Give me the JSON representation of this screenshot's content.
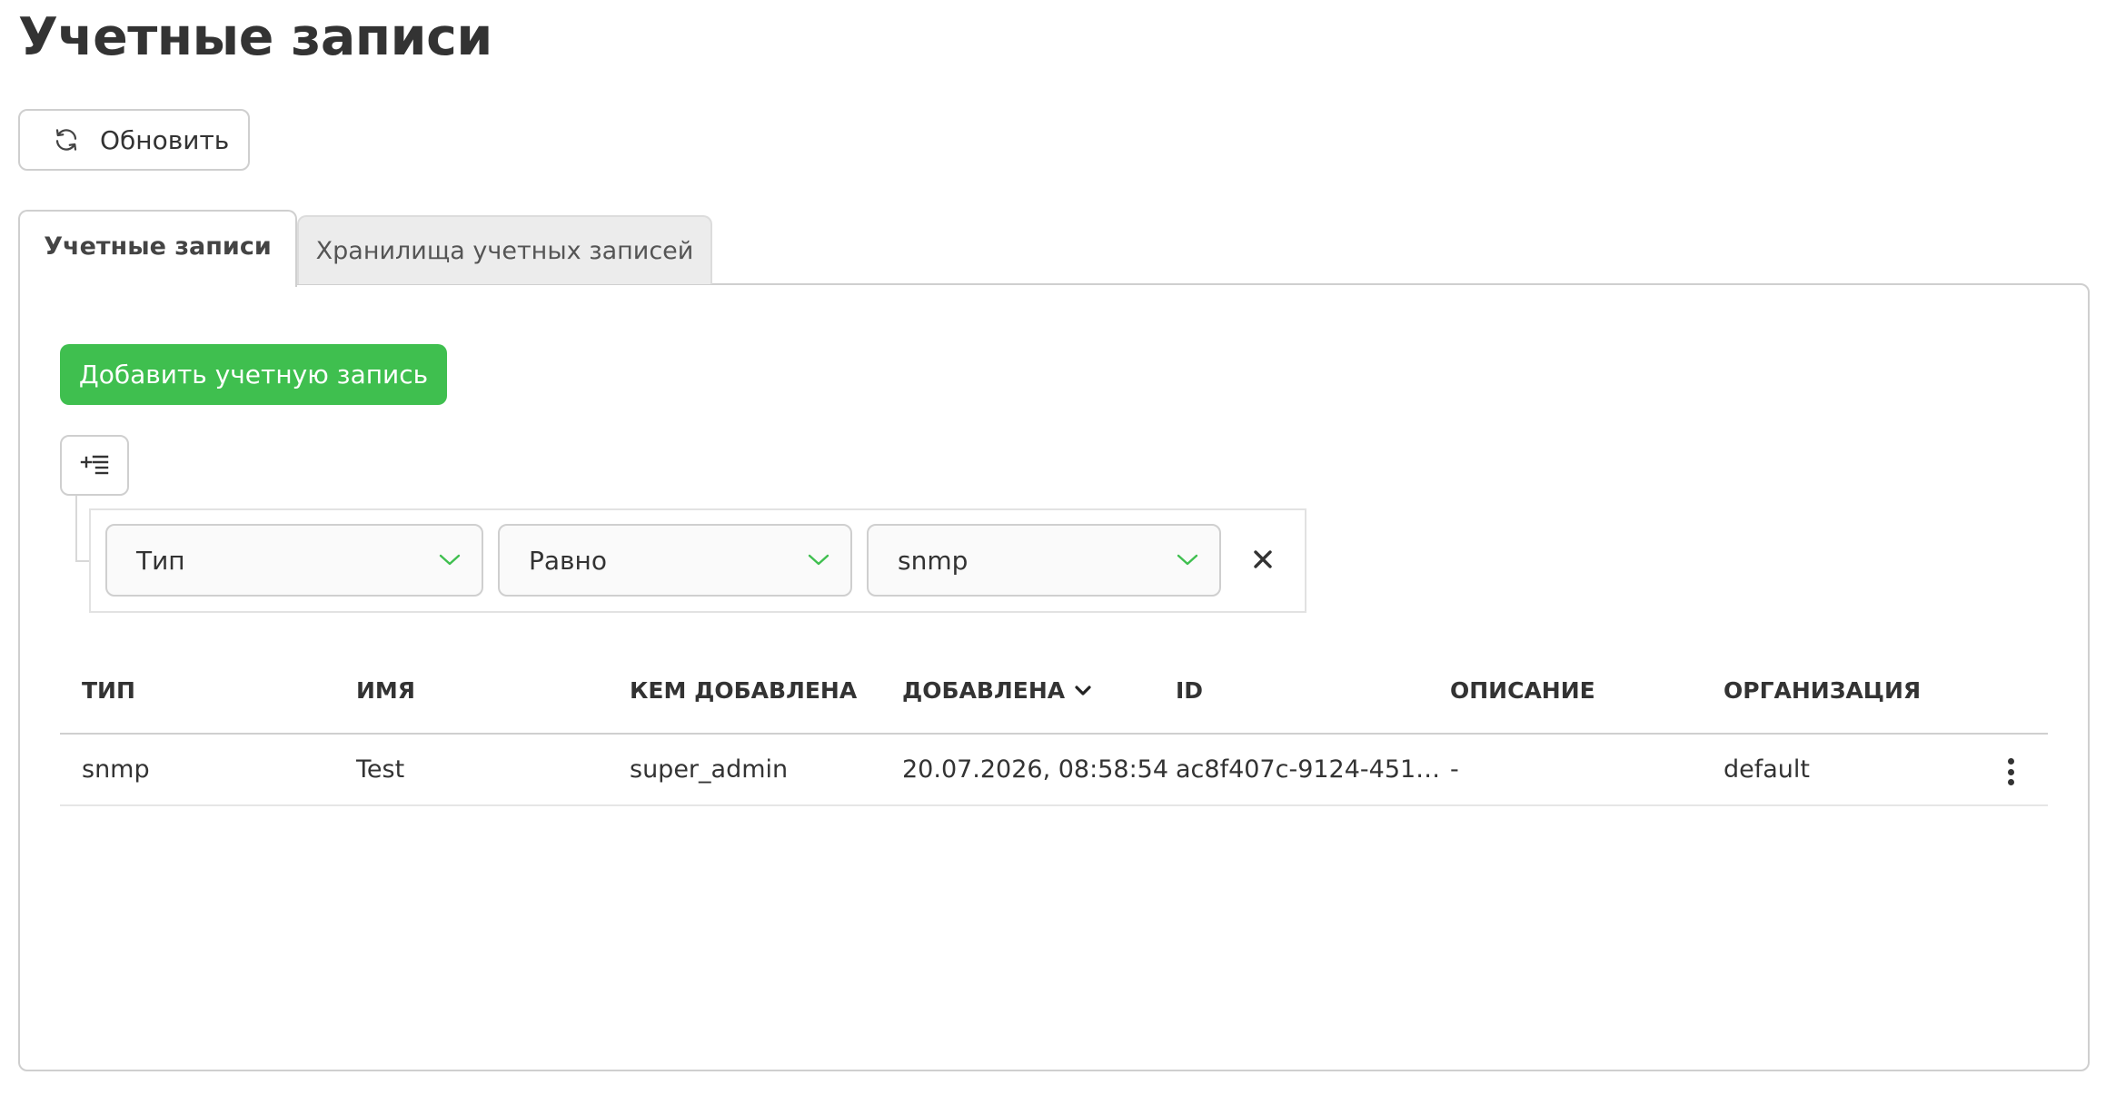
{
  "page": {
    "title": "Учетные записи"
  },
  "toolbar": {
    "refresh_label": "Обновить",
    "refresh_icon": "refresh-icon"
  },
  "tabs": [
    {
      "label": "Учетные записи",
      "active": true
    },
    {
      "label": "Хранилища учетных записей",
      "active": false
    }
  ],
  "actions": {
    "add_label": "Добавить учетную запись"
  },
  "filter": {
    "add_icon": "add-filter-icon",
    "field": "Тип",
    "operator": "Равно",
    "value": "snmp",
    "remove_icon": "close-icon"
  },
  "table": {
    "columns": [
      "ТИП",
      "ИМЯ",
      "КЕМ ДОБАВЛЕНА",
      "ДОБАВЛЕНА",
      "ID",
      "ОПИСАНИЕ",
      "ОРГАНИЗАЦИЯ"
    ],
    "sorted_column": "ДОБАВЛЕНА",
    "sort_direction": "desc",
    "rows": [
      [
        "snmp",
        "Test",
        "super_admin",
        "20.07.2026, 08:58:54",
        "ac8f407c-9124-451…",
        "-",
        "default"
      ]
    ]
  },
  "colors": {
    "accent_green": "#3fbf4f",
    "chevron_green": "#3fbf4f",
    "text": "#333333",
    "border": "#cfcfcf"
  }
}
